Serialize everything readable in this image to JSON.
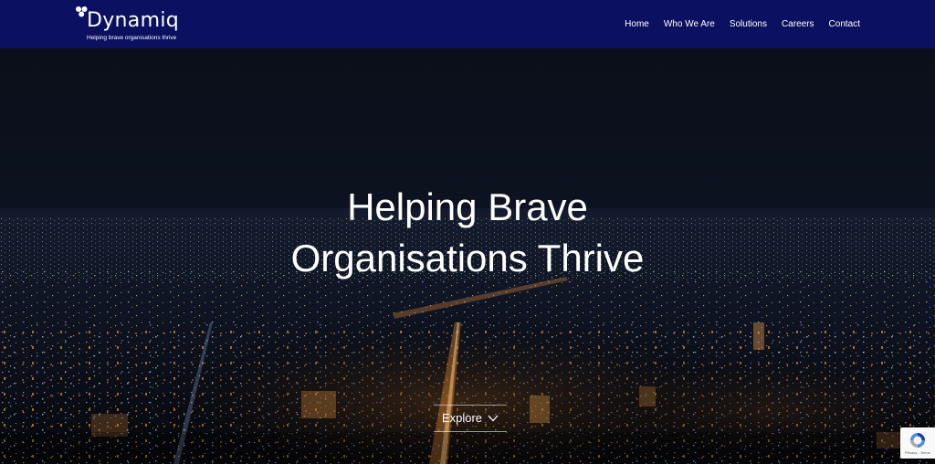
{
  "brand": {
    "name": "Dynamiq",
    "tagline": "Helping brave organisations thrive"
  },
  "nav": {
    "items": [
      {
        "label": "Home"
      },
      {
        "label": "Who We Are"
      },
      {
        "label": "Solutions"
      },
      {
        "label": "Careers"
      },
      {
        "label": "Contact"
      }
    ]
  },
  "hero": {
    "title_line1": "Helping Brave",
    "title_line2": "Organisations Thrive",
    "explore_label": "Explore",
    "background_image": "night city skyline"
  },
  "recaptcha": {
    "links": "Privacy - Terms"
  },
  "colors": {
    "header_bg": "#0b1160",
    "text": "#ffffff",
    "hero_bg": "#0a0c12"
  },
  "icons": {
    "logo": "hexagon-cluster-logo",
    "explore": "chevron-down-icon",
    "recaptcha": "recaptcha-icon"
  }
}
